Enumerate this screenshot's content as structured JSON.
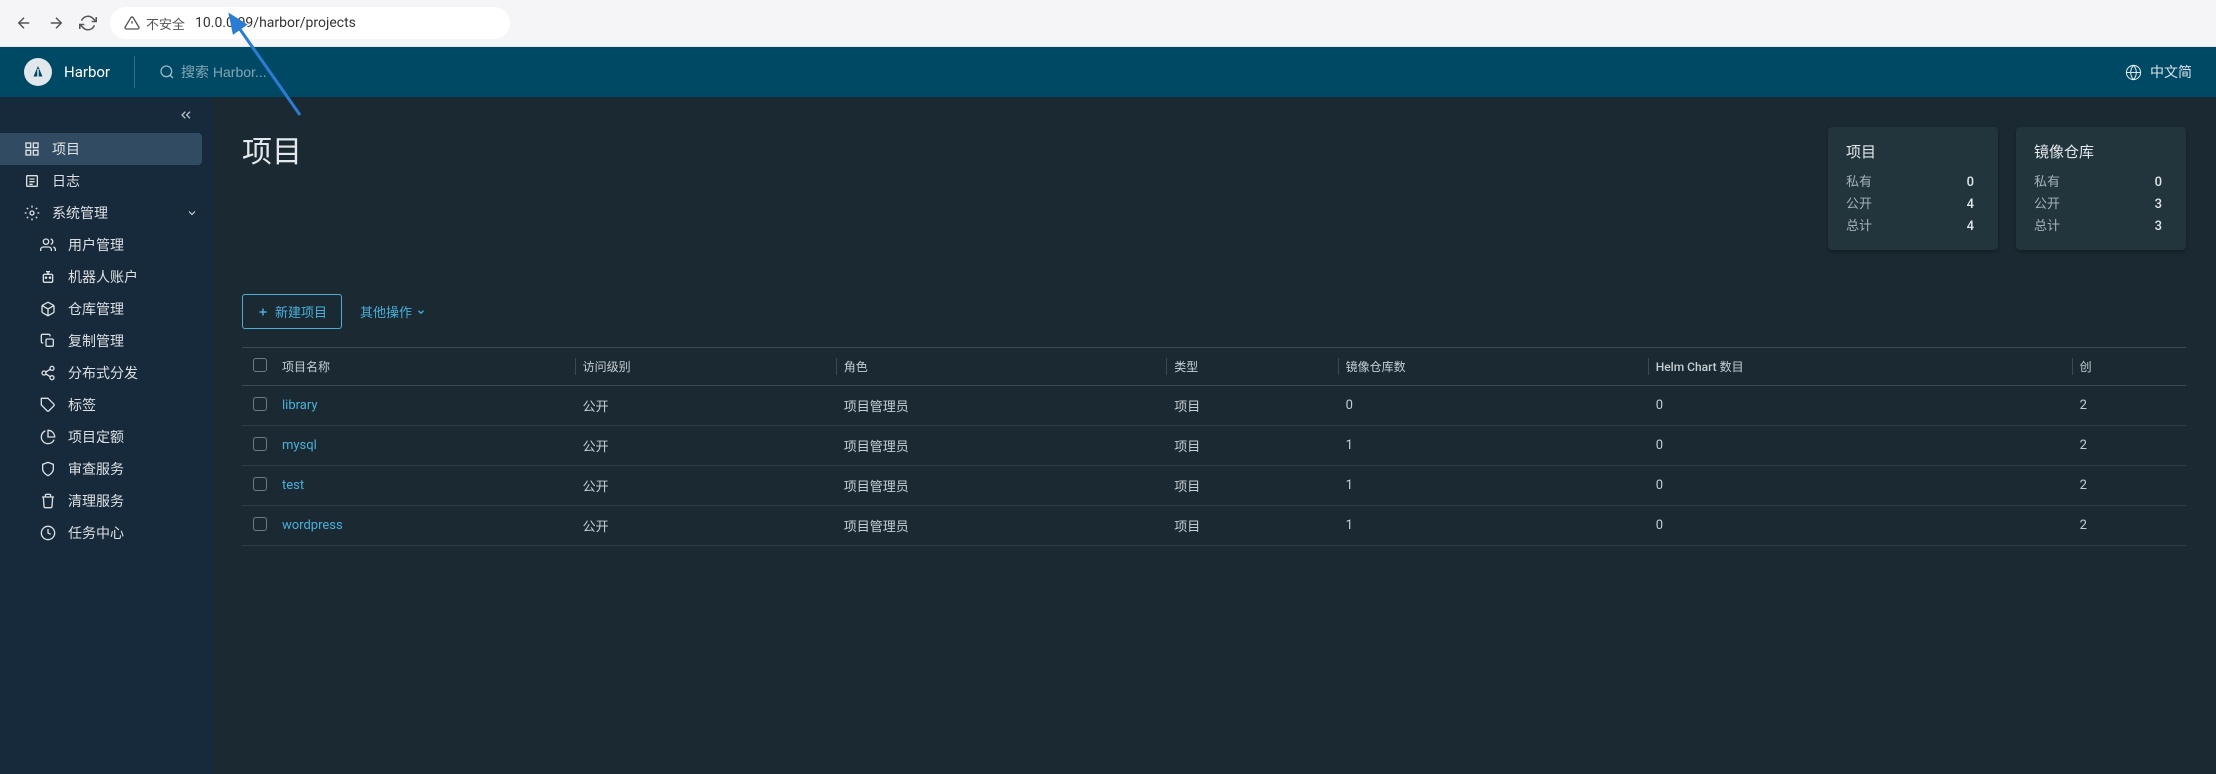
{
  "browser": {
    "insecure_label": "不安全",
    "url": "10.0.0.99/harbor/projects"
  },
  "header": {
    "app_name": "Harbor",
    "search_placeholder": "搜索 Harbor...",
    "lang_label": "中文简"
  },
  "sidebar": {
    "projects": "项目",
    "logs": "日志",
    "system": "系统管理",
    "users": "用户管理",
    "robots": "机器人账户",
    "repos": "仓库管理",
    "replication": "复制管理",
    "distribution": "分布式分发",
    "labels": "标签",
    "quotas": "项目定额",
    "audit": "审查服务",
    "cleanup": "清理服务",
    "tasks": "任务中心"
  },
  "page": {
    "title": "项目",
    "cards": {
      "project": {
        "title": "项目",
        "private_label": "私有",
        "private_val": "0",
        "public_label": "公开",
        "public_val": "4",
        "total_label": "总计",
        "total_val": "4"
      },
      "repo": {
        "title": "镜像仓库",
        "private_label": "私有",
        "private_val": "0",
        "public_label": "公开",
        "public_val": "3",
        "total_label": "总计",
        "total_val": "3"
      }
    },
    "toolbar": {
      "new_project": "新建项目",
      "other_actions": "其他操作"
    },
    "table": {
      "headers": {
        "name": "项目名称",
        "access": "访问级别",
        "role": "角色",
        "type": "类型",
        "repo_count": "镜像仓库数",
        "helm_count": "Helm Chart 数目",
        "created": "创"
      },
      "rows": [
        {
          "name": "library",
          "access": "公开",
          "role": "项目管理员",
          "type": "项目",
          "repo_count": "0",
          "helm_count": "0",
          "created": "2"
        },
        {
          "name": "mysql",
          "access": "公开",
          "role": "项目管理员",
          "type": "项目",
          "repo_count": "1",
          "helm_count": "0",
          "created": "2"
        },
        {
          "name": "test",
          "access": "公开",
          "role": "项目管理员",
          "type": "项目",
          "repo_count": "1",
          "helm_count": "0",
          "created": "2"
        },
        {
          "name": "wordpress",
          "access": "公开",
          "role": "项目管理员",
          "type": "项目",
          "repo_count": "1",
          "helm_count": "0",
          "created": "2"
        }
      ]
    }
  }
}
